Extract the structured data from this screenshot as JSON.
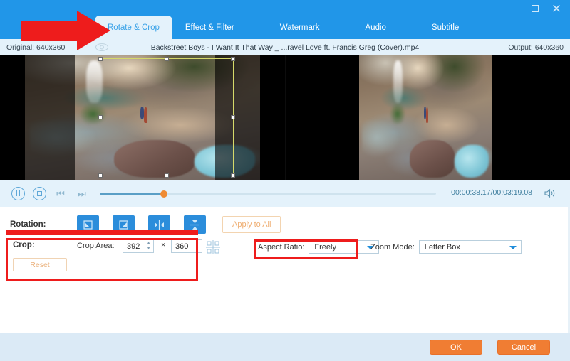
{
  "window": {
    "maximize_icon": "maximize-icon",
    "close_icon": "close-icon"
  },
  "tabs": [
    {
      "label": "Rotate & Crop",
      "active": true
    },
    {
      "label": "Effect & Filter",
      "active": false
    },
    {
      "label": "Watermark",
      "active": false
    },
    {
      "label": "Audio",
      "active": false
    },
    {
      "label": "Subtitle",
      "active": false
    }
  ],
  "infobar": {
    "original": "Original: 640x360",
    "file_title": "Backstreet Boys - I Want It That Way _ ...ravel Love ft. Francis Greg (Cover).mp4",
    "output": "Output: 640x360",
    "eye_icon": "eye-icon"
  },
  "player": {
    "pause_icon": "pause-icon",
    "stop_icon": "stop-icon",
    "prev_icon": "previous-frame-icon",
    "next_icon": "next-frame-icon",
    "timecode": "00:00:38.17/00:03:19.08",
    "current_time": "00:00:38.17",
    "total_time": "00:03:19.08",
    "progress_percent": 19,
    "volume_icon": "volume-icon"
  },
  "rotation": {
    "label": "Rotation:",
    "buttons": [
      {
        "name": "rotate-left-button",
        "glyph": "rotate-counterclockwise-icon"
      },
      {
        "name": "rotate-right-button",
        "glyph": "rotate-clockwise-icon"
      },
      {
        "name": "flip-horizontal-button",
        "glyph": "flip-horizontal-icon"
      },
      {
        "name": "flip-vertical-button",
        "glyph": "flip-vertical-icon"
      }
    ],
    "apply_to_all": "Apply to All"
  },
  "crop": {
    "label": "Crop:",
    "area_label": "Crop Area:",
    "width": "392",
    "height": "360",
    "separator": "×",
    "reset": "Reset",
    "move_icon": "crosshair-move-icon"
  },
  "aspect_ratio": {
    "label": "Aspect Ratio:",
    "value": "Freely"
  },
  "zoom_mode": {
    "label": "Zoom Mode:",
    "value": "Letter Box"
  },
  "footer": {
    "ok": "OK",
    "cancel": "Cancel"
  },
  "annotations": {
    "arrow_color": "#ee1c1c",
    "box_color": "#ee1c1c"
  },
  "colors": {
    "header_blue": "#2196e8",
    "tab_active_bg": "#e4f2fb",
    "accent_orange": "#f07d33",
    "button_blue": "#2b8ddb",
    "panel_bg": "#ffffff"
  }
}
